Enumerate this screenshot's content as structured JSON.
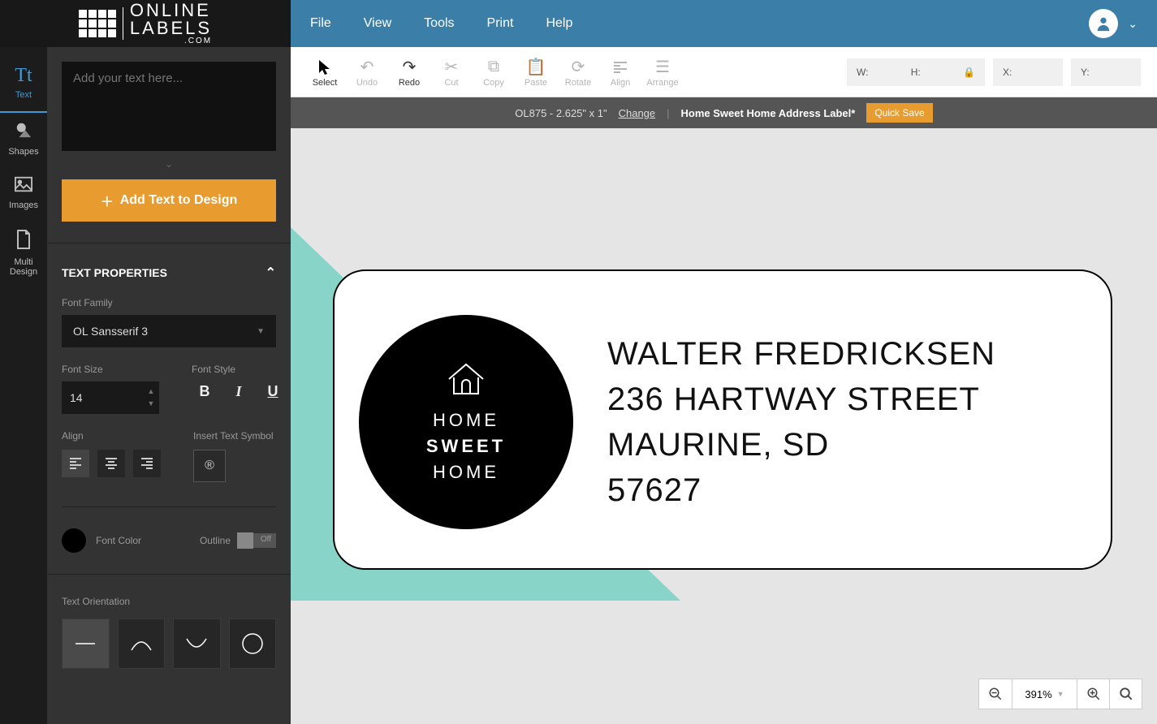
{
  "brand": {
    "name_top": "ONLINE",
    "name_bottom": "LABELS",
    "tld": ".COM"
  },
  "menu": {
    "file": "File",
    "view": "View",
    "tools": "Tools",
    "print": "Print",
    "help": "Help"
  },
  "rail": {
    "text": "Text",
    "shapes": "Shapes",
    "images": "Images",
    "multi_line1": "Multi",
    "multi_line2": "Design"
  },
  "panel": {
    "placeholder": "Add your text here...",
    "add_btn": "Add Text to Design",
    "props_title": "TEXT PROPERTIES",
    "font_family_label": "Font Family",
    "font_family_value": "OL Sansserif 3",
    "font_size_label": "Font Size",
    "font_size_value": "14",
    "font_style_label": "Font Style",
    "align_label": "Align",
    "insert_symbol_label": "Insert Text Symbol",
    "symbol_glyph": "®",
    "font_color_label": "Font Color",
    "font_color": "#000000",
    "outline_label": "Outline",
    "outline_state": "Off",
    "orientation_label": "Text Orientation"
  },
  "toolbar": {
    "select": "Select",
    "undo": "Undo",
    "redo": "Redo",
    "cut": "Cut",
    "copy": "Copy",
    "paste": "Paste",
    "rotate": "Rotate",
    "align": "Align",
    "arrange": "Arrange",
    "w": "W:",
    "h": "H:",
    "x": "X:",
    "y": "Y:"
  },
  "docbar": {
    "spec": "OL875 - 2.625\" x 1\"",
    "change": "Change",
    "title": "Home Sweet Home Address Label*",
    "quick_save": "Quick Save"
  },
  "label": {
    "circle_line1": "HOME",
    "circle_line2": "SWEET",
    "circle_line3": "HOME",
    "name": "WALTER FREDRICKSEN",
    "street": "236 HARTWAY STREET",
    "city": "MAURINE, SD",
    "zip": "57627"
  },
  "zoom": {
    "value": "391%"
  }
}
